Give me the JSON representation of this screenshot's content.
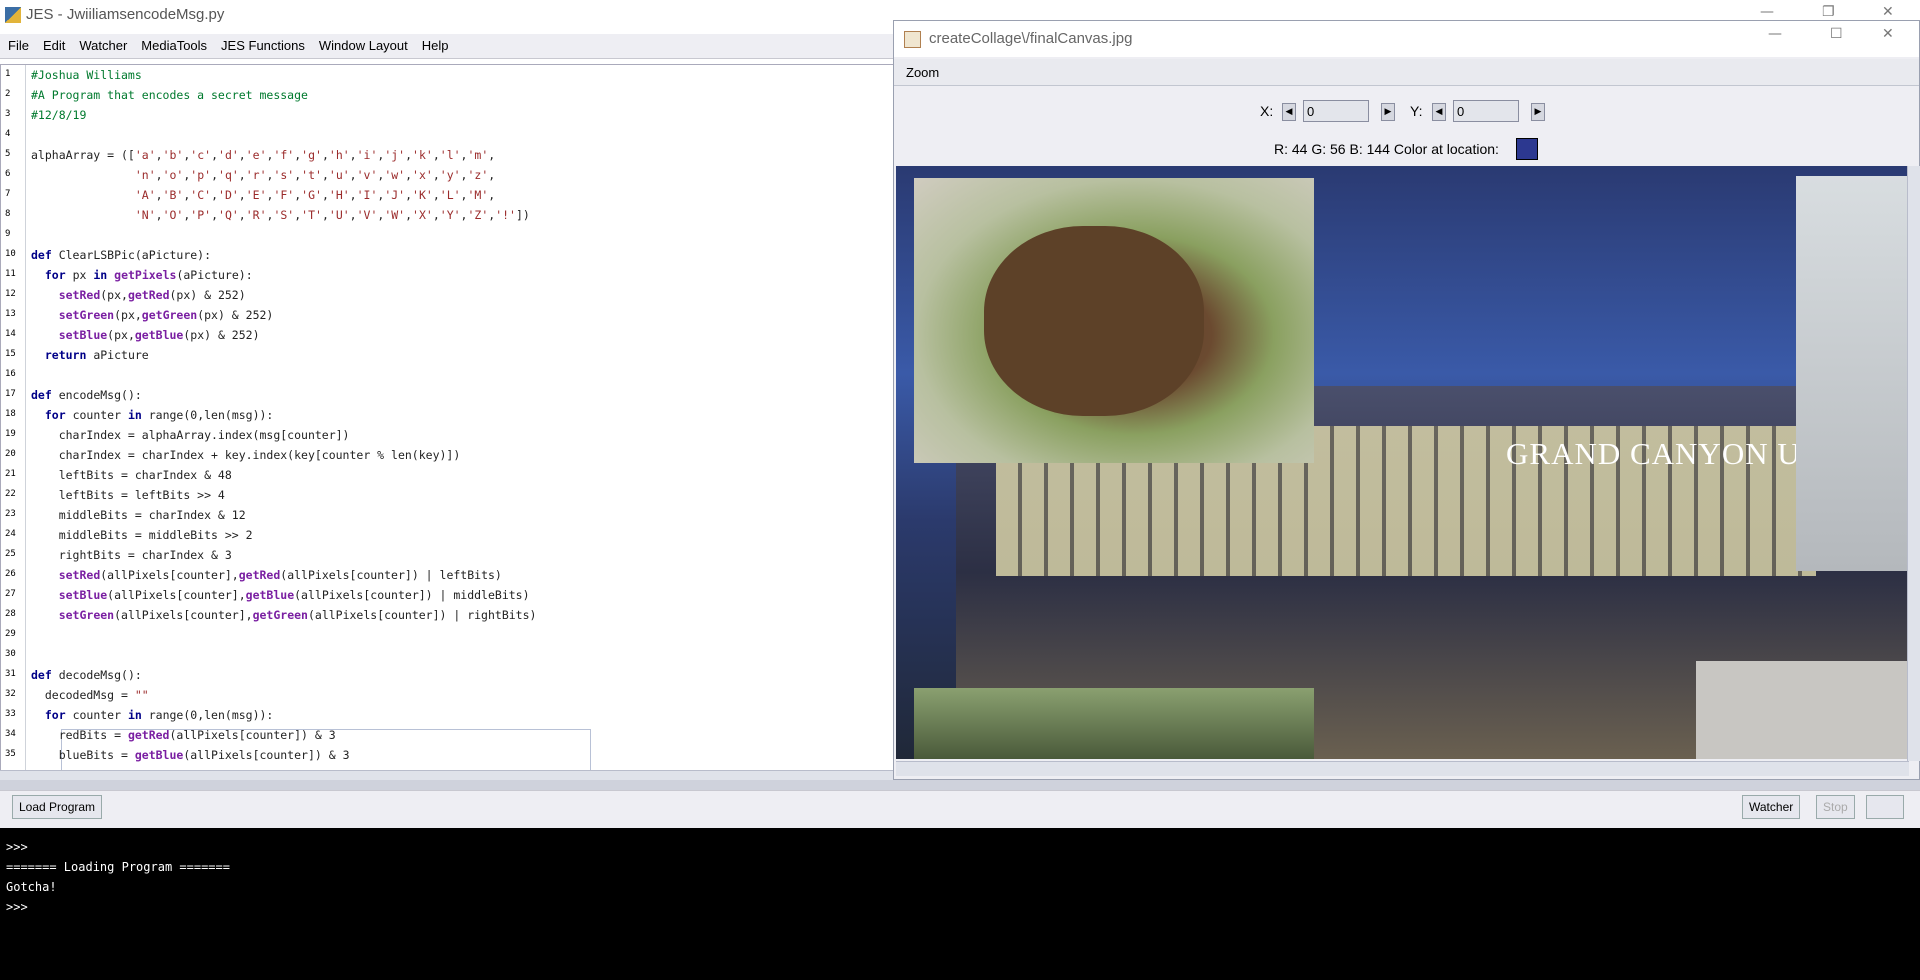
{
  "window_title": "JES - JwiiliamsencodeMsg.py",
  "menu": [
    "File",
    "Edit",
    "Watcher",
    "MediaTools",
    "JES Functions",
    "Window Layout",
    "Help"
  ],
  "editor": {
    "line_numbers": [
      "1",
      "2",
      "3",
      "4",
      "5",
      "6",
      "7",
      "8",
      "9",
      "10",
      "11",
      "12",
      "13",
      "14",
      "15",
      "16",
      "17",
      "18",
      "19",
      "20",
      "21",
      "22",
      "23",
      "24",
      "25",
      "26",
      "27",
      "28",
      "29",
      "30",
      "31",
      "32",
      "33",
      "34",
      "35"
    ],
    "lines": [
      "#Joshua Williams",
      "#A Program that encodes a secret message",
      "#12/8/19",
      "",
      "alphaArray = (['a','b','c','d','e','f','g','h','i','j','k','l','m',",
      "               'n','o','p','q','r','s','t','u','v','w','x','y','z',",
      "               'A','B','C','D','E','F','G','H','I','J','K','L','M',",
      "               'N','O','P','Q','R','S','T','U','V','W','X','Y','Z','!'])",
      "",
      "def ClearLSBPic(aPicture):",
      "  for px in getPixels(aPicture):",
      "    setRed(px,getRed(px) & 252)",
      "    setGreen(px,getGreen(px) & 252)",
      "    setBlue(px,getBlue(px) & 252)",
      "  return aPicture",
      "",
      "def encodeMsg():",
      "  for counter in range(0,len(msg)):",
      "    charIndex = alphaArray.index(msg[counter])",
      "    charIndex = charIndex + key.index(key[counter % len(key)])",
      "    leftBits = charIndex & 48",
      "    leftBits = leftBits >> 4",
      "    middleBits = charIndex & 12",
      "    middleBits = middleBits >> 2",
      "    rightBits = charIndex & 3",
      "    setRed(allPixels[counter],getRed(allPixels[counter]) | leftBits)",
      "    setBlue(allPixels[counter],getBlue(allPixels[counter]) | middleBits)",
      "    setGreen(allPixels[counter],getGreen(allPixels[counter]) | rightBits)",
      "",
      "",
      "def decodeMsg():",
      "  decodedMsg = \"\"",
      "  for counter in range(0,len(msg)):",
      "    redBits = getRed(allPixels[counter]) & 3",
      "    blueBits = getBlue(allPixels[counter]) & 3"
    ]
  },
  "explorer": {
    "title": "createCollage\\/finalCanvas.jpg",
    "menu": "Zoom",
    "x_label": "X:",
    "x_value": "0",
    "y_label": "Y:",
    "y_value": "0",
    "color_readout": "R: 44 G: 56 B: 144 Color at location:",
    "swatch_color": "#2c3890",
    "sign_text": "GRAND CANYON UNIVER"
  },
  "buttons": {
    "load": "Load Program",
    "watcher": "Watcher",
    "stop": "Stop"
  },
  "console": [
    ">>>",
    "======= Loading Program =======",
    "Gotcha!",
    ">>>"
  ]
}
